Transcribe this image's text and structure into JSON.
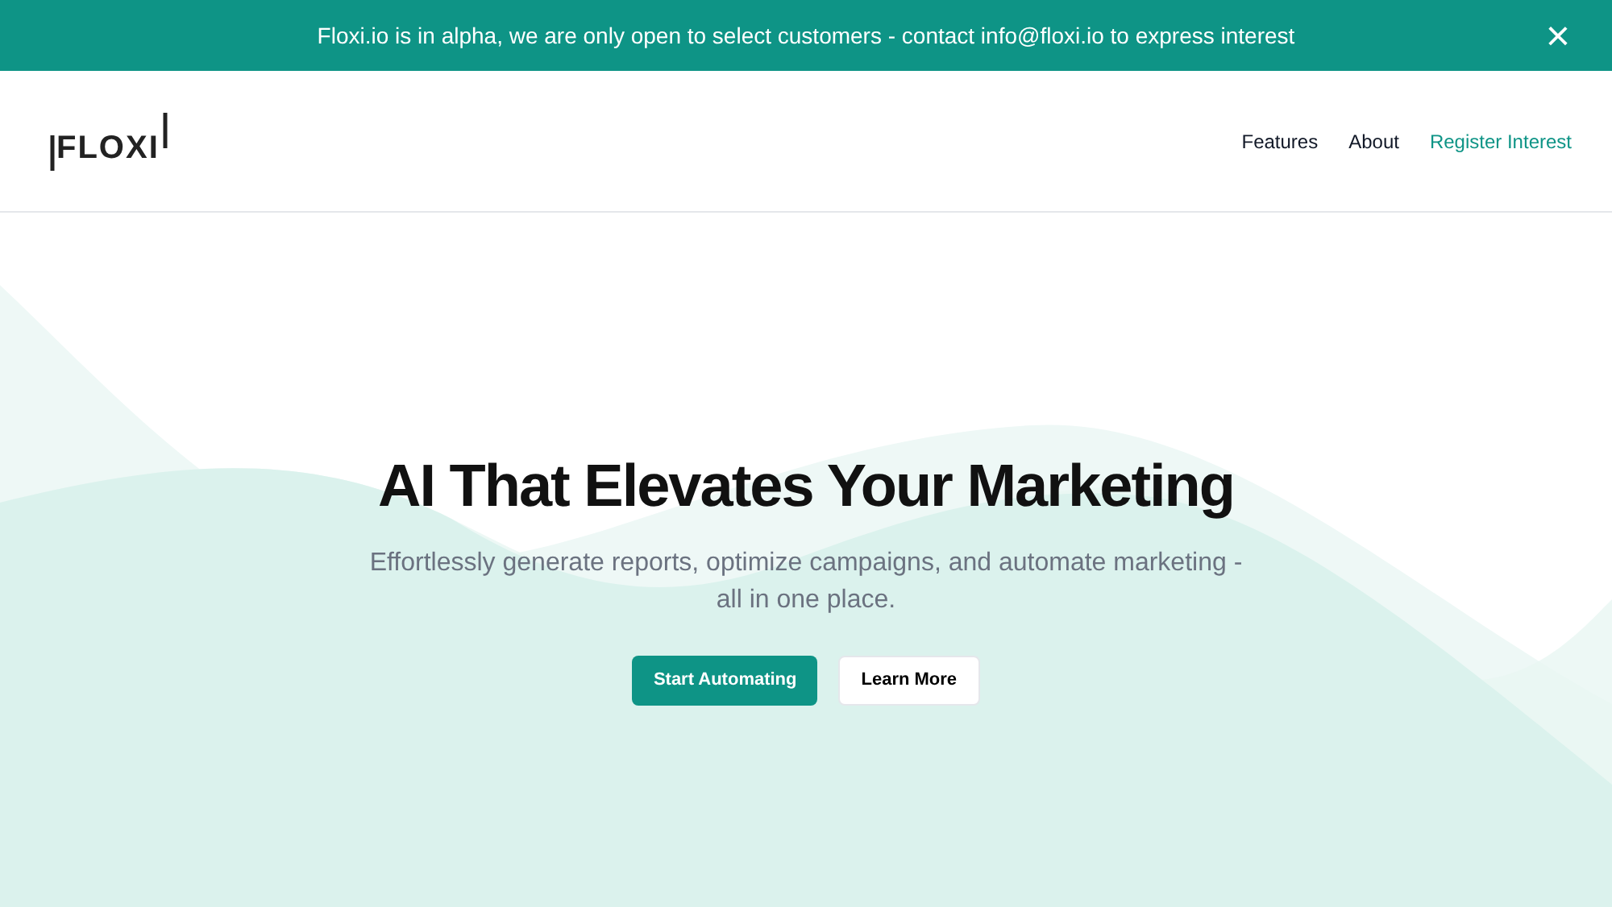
{
  "banner": {
    "text": "Floxi.io is in alpha, we are only open to select customers - contact info@floxi.io to express interest",
    "close": "×"
  },
  "header": {
    "logo": "FLOXI",
    "nav": [
      {
        "label": "Features",
        "kind": "link"
      },
      {
        "label": "About",
        "kind": "link"
      },
      {
        "label": "Register Interest",
        "kind": "accent"
      }
    ]
  },
  "hero": {
    "title": "AI That Elevates Your Marketing",
    "subtitle": "Effortlessly generate reports, optimize campaigns, and automate marketing - all in one place.",
    "buttons": [
      {
        "label": "Start Automating",
        "kind": "primary"
      },
      {
        "label": "Learn More",
        "kind": "secondary"
      }
    ]
  }
}
